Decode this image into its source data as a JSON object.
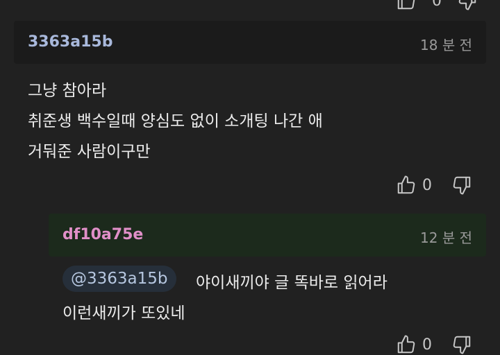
{
  "top_votes_partial": {
    "up_count": "0"
  },
  "comment": {
    "author": "3363a15b",
    "time": "18 분 전",
    "lines": [
      "그냥 참아라",
      "취준생 백수일때 양심도 없이 소개팅 나간 애",
      "거둬준 사람이구만"
    ],
    "upvotes": "0",
    "colors": {
      "author": "#a9b9dc",
      "header_bg": "#1b1b1b"
    }
  },
  "reply": {
    "author": "df10a75e",
    "time": "12 분 전",
    "mention": "@3363a15b",
    "line1_rest": "야이새끼야 글 똑바로 읽어라",
    "line2": "이런새끼가 또있네",
    "upvotes": "0",
    "colors": {
      "author": "#e08fc8",
      "header_bg": "#1c2a1c"
    }
  },
  "icons": {
    "upvote": "thumbs-up-icon",
    "downvote": "thumbs-down-icon"
  }
}
